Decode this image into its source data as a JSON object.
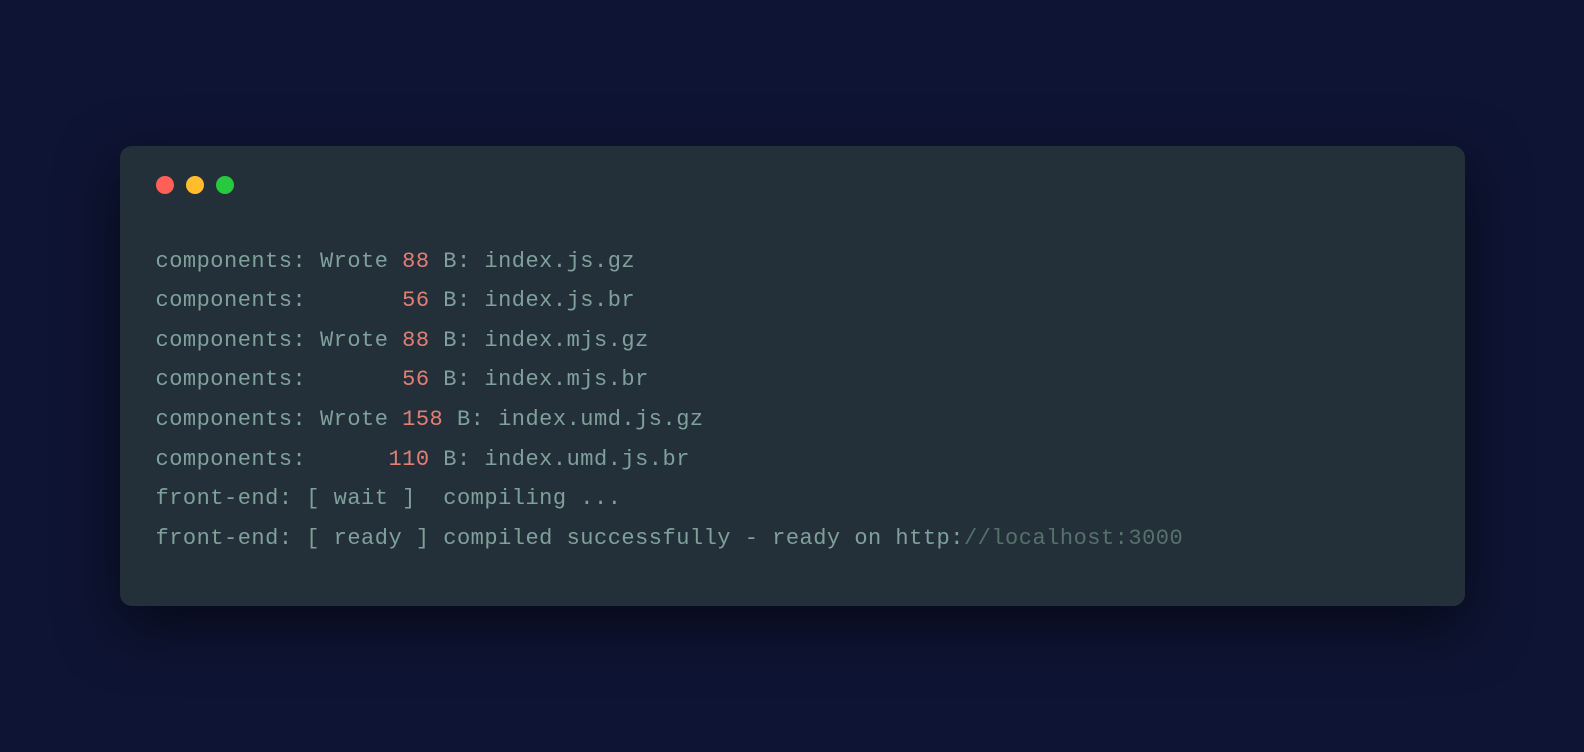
{
  "terminal": {
    "lines": [
      {
        "prefix": "components",
        "action": "Wrote",
        "size": "88",
        "unit": "B",
        "filename": "index.js.gz"
      },
      {
        "prefix": "components",
        "action": "",
        "size": "56",
        "unit": "B",
        "filename": "index.js.br"
      },
      {
        "prefix": "components",
        "action": "Wrote",
        "size": "88",
        "unit": "B",
        "filename": "index.mjs.gz"
      },
      {
        "prefix": "components",
        "action": "",
        "size": "56",
        "unit": "B",
        "filename": "index.mjs.br"
      },
      {
        "prefix": "components",
        "action": "Wrote",
        "size": "158",
        "unit": "B",
        "filename": "index.umd.js.gz"
      },
      {
        "prefix": "components",
        "action": "",
        "size": "110",
        "unit": "B",
        "filename": "index.umd.js.br"
      }
    ],
    "status": [
      {
        "prefix": "front-end",
        "bracket": "[ wait ]",
        "message": " compiling ...",
        "url": ""
      },
      {
        "prefix": "front-end",
        "bracket": "[ ready ]",
        "message": "compiled successfully - ready on http:",
        "url": "//localhost:3000"
      }
    ]
  },
  "colors": {
    "background": "#0e1433",
    "terminal_bg": "#243039",
    "text_primary": "#7fa09b",
    "text_number": "#e27e73",
    "text_muted": "#56706c",
    "traffic_red": "#ff5f56",
    "traffic_yellow": "#ffbd2e",
    "traffic_green": "#27c93f"
  }
}
